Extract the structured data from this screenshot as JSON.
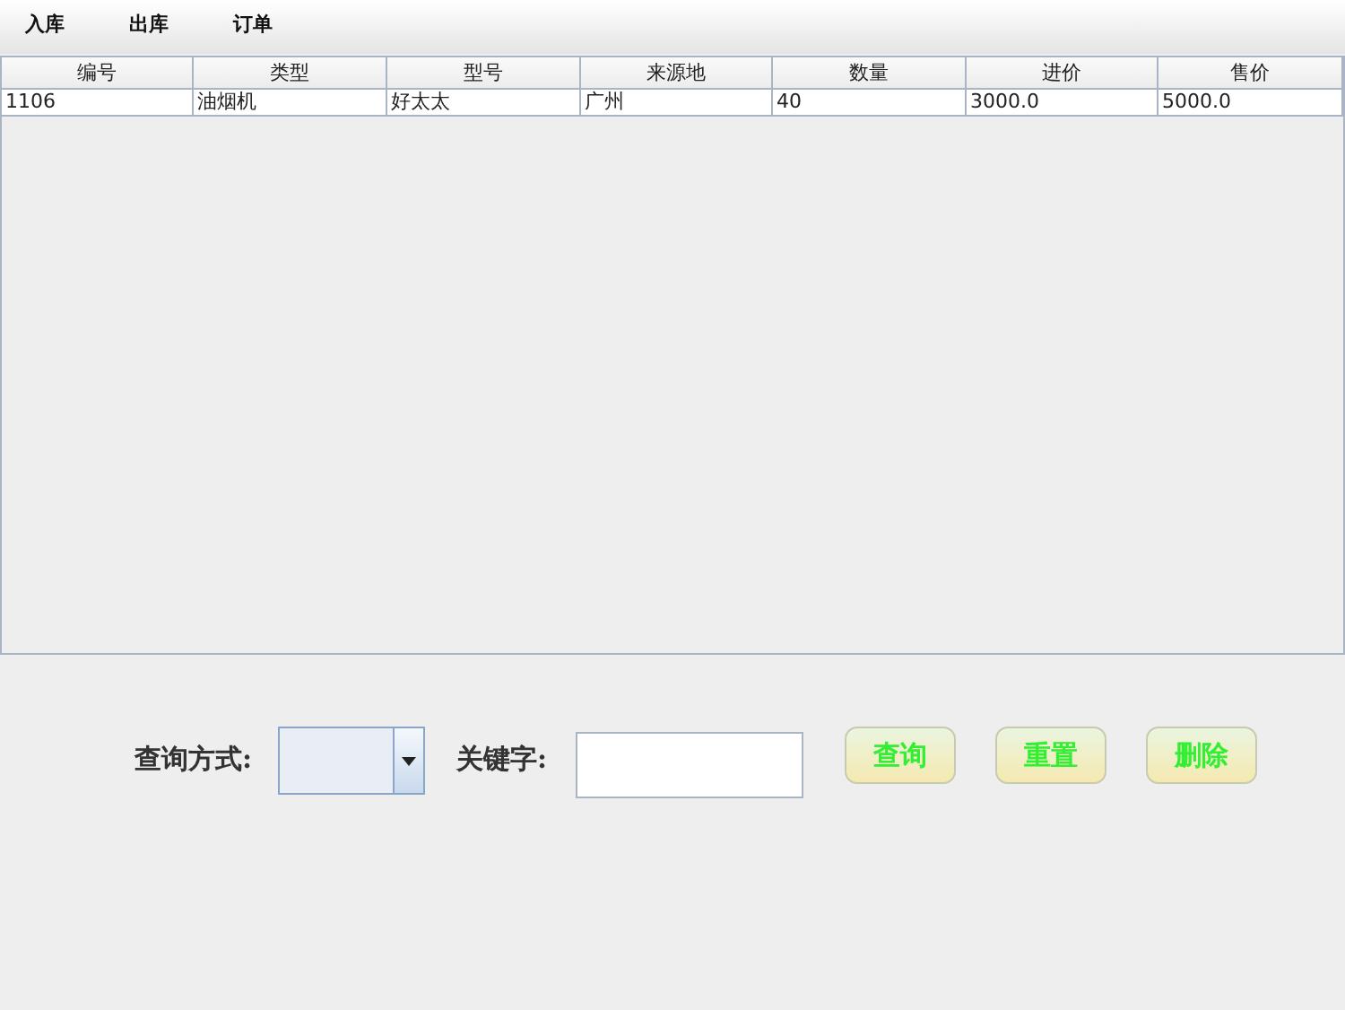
{
  "menu": [
    "入库",
    "出库",
    "订单"
  ],
  "table": {
    "columns": [
      "编号",
      "类型",
      "型号",
      "来源地",
      "数量",
      "进价",
      "售价"
    ],
    "rows": [
      [
        "1106",
        "油烟机",
        "好太太",
        "广州",
        "40",
        "3000.0",
        "5000.0"
      ]
    ]
  },
  "search": {
    "mode_label": "查询方式:",
    "keyword_label": "关键字:"
  },
  "buttons": [
    "查询",
    "重置",
    "删除"
  ]
}
